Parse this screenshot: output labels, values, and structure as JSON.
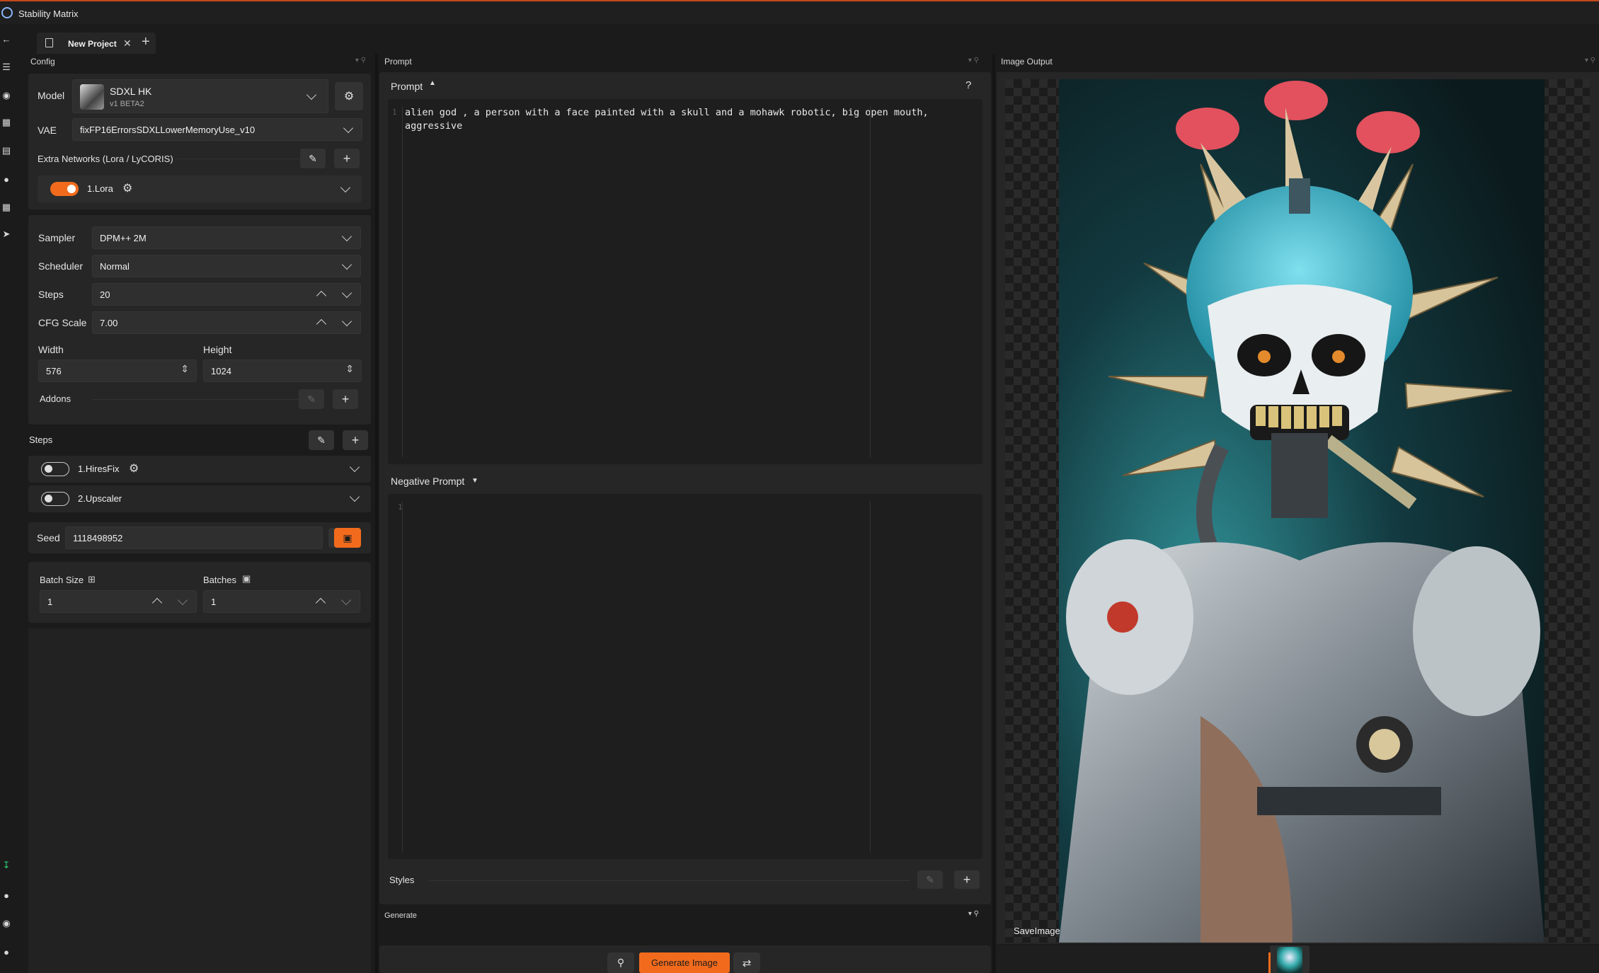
{
  "app": {
    "title": "Stability Matrix"
  },
  "tabs": [
    {
      "label": "New Project"
    }
  ],
  "panels": {
    "config": "Config",
    "prompt": "Prompt",
    "image_output": "Image Output",
    "generate": "Generate"
  },
  "config": {
    "model": {
      "label": "Model",
      "name": "SDXL HK",
      "version": "v1 BETA2"
    },
    "vae": {
      "label": "VAE",
      "value": "fixFP16ErrorsSDXLLowerMemoryUse_v10"
    },
    "extra_networks": {
      "label": "Extra Networks (Lora / LyCORIS)",
      "items": [
        {
          "label": "1.Lora",
          "enabled": true
        }
      ]
    },
    "sampler": {
      "label": "Sampler",
      "value": "DPM++ 2M"
    },
    "scheduler": {
      "label": "Scheduler",
      "value": "Normal"
    },
    "steps": {
      "label": "Steps",
      "value": "20"
    },
    "cfg": {
      "label": "CFG Scale",
      "value": "7.00"
    },
    "width": {
      "label": "Width",
      "value": "576"
    },
    "height": {
      "label": "Height",
      "value": "1024"
    },
    "addons": {
      "label": "Addons"
    }
  },
  "steps_section": {
    "label": "Steps",
    "items": [
      {
        "label": "1.HiresFix",
        "enabled": false
      },
      {
        "label": "2.Upscaler",
        "enabled": false
      }
    ]
  },
  "seed": {
    "label": "Seed",
    "value": "1118498952"
  },
  "batch": {
    "size_label": "Batch Size",
    "size_value": "1",
    "batches_label": "Batches",
    "batches_value": "1"
  },
  "prompt": {
    "title": "Prompt",
    "help": "?",
    "line_number": "1",
    "text": "alien god , a person with a face painted with a skull and a mohawk robotic, big open mouth, aggressive"
  },
  "negative_prompt": {
    "title": "Negative Prompt",
    "line_number": "1",
    "text": ""
  },
  "styles": {
    "label": "Styles"
  },
  "generate": {
    "button_label": "Generate Image"
  },
  "image_output": {
    "overlay_label": "SaveImage"
  },
  "colors": {
    "accent": "#f26b1d",
    "background": "#1b1b1b",
    "card": "#262626"
  }
}
